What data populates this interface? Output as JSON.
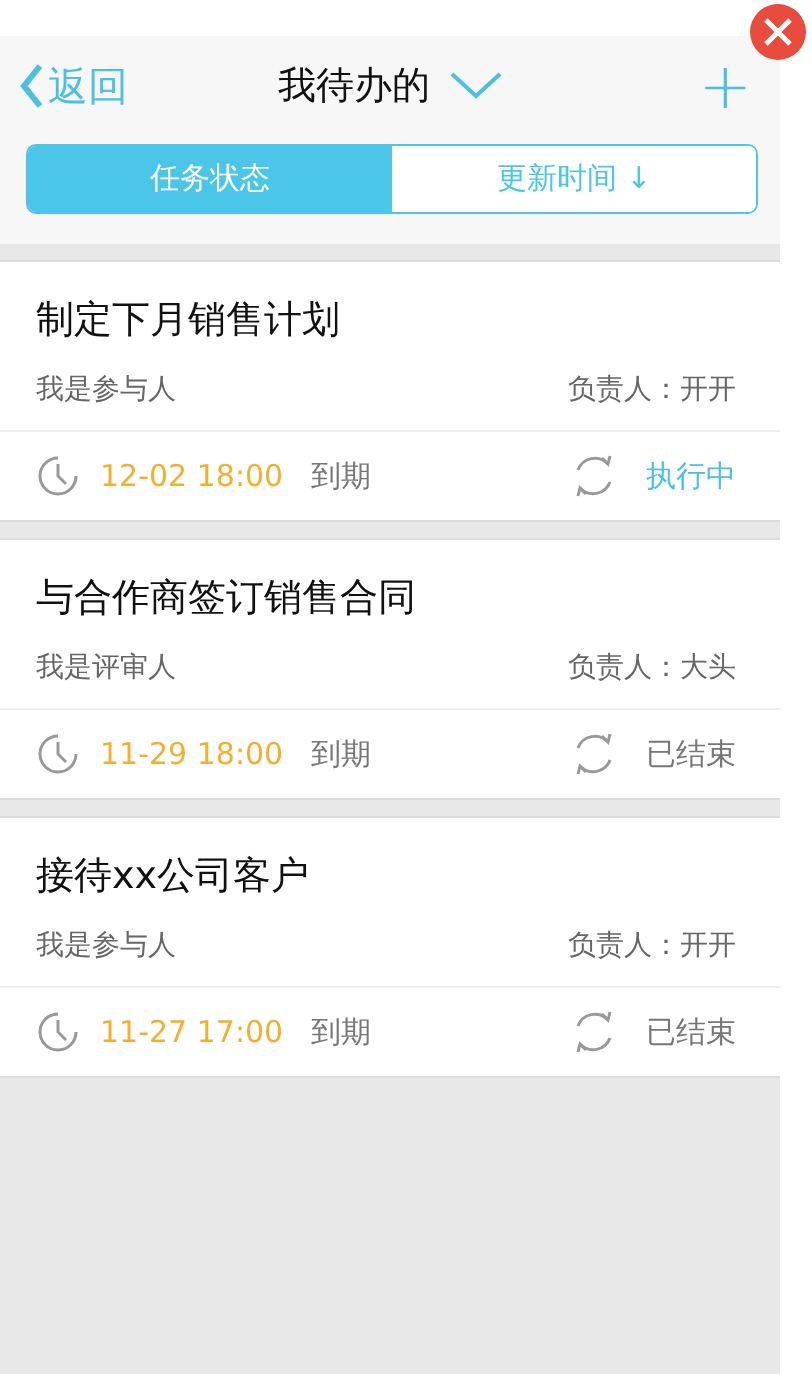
{
  "header": {
    "back": "返回",
    "title": "我待办的",
    "add": "+"
  },
  "tabs": [
    {
      "label": "任务状态",
      "selected": true
    },
    {
      "label": "更新时间",
      "selected": false,
      "sort": "↓"
    }
  ],
  "tasks": [
    {
      "title": "制定下月销售计划",
      "role": "我是参与人",
      "owner": "负责人：开开",
      "due_time": "12-02 18:00",
      "due_label": "到期",
      "status": {
        "text": "执行中",
        "color": "#4bbfe4"
      }
    },
    {
      "title": "与合作商签订销售合同",
      "role": "我是评审人",
      "owner": "负责人：大头",
      "due_time": "11-29 18:00",
      "due_label": "到期",
      "status": {
        "text": "已结束",
        "color": "#777777"
      }
    },
    {
      "title": "接待xx公司客户",
      "role": "我是参与人",
      "owner": "负责人：开开",
      "due_time": "11-27 17:00",
      "due_label": "到期",
      "status": {
        "text": "已结束",
        "color": "#777777"
      }
    }
  ]
}
